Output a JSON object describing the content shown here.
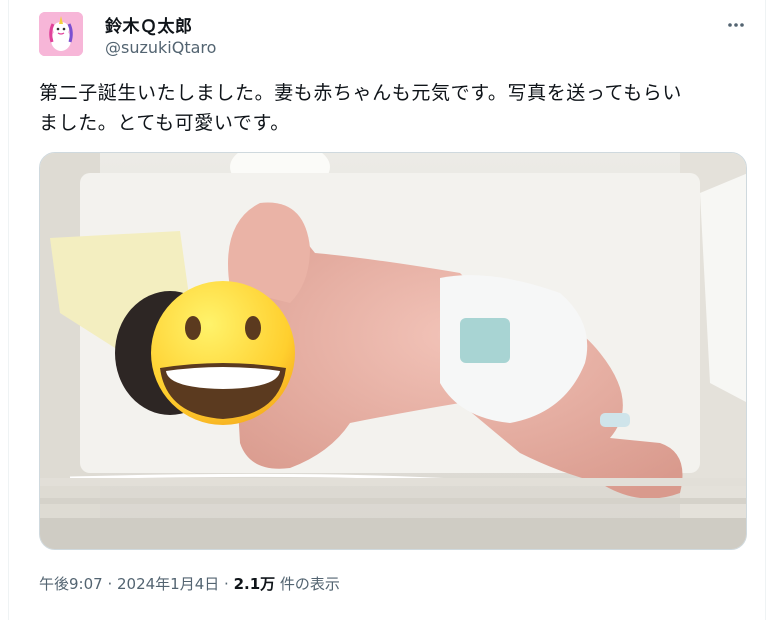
{
  "author": {
    "display_name": "鈴木Ｑ太郎",
    "handle": "@suzukiQtaro",
    "avatar_icon": "cartoon-unicorn-avatar"
  },
  "tweet": {
    "text_line1": "第二子誕生いたしました。妻も赤ちゃんも元気です。写真を送ってもらい",
    "text_line2": "ました。とても可愛いです。"
  },
  "media": {
    "face_cover_icon": "grinning-face-emoji"
  },
  "meta": {
    "time": "午後9:07",
    "separator": " · ",
    "date": "2024年1月4日",
    "views_count": "2.1万",
    "views_label": " 件の表示"
  },
  "colors": {
    "text": "#0f1419",
    "muted": "#536471",
    "border": "#cfd9de",
    "avatar_bg": "#f5a9d1"
  }
}
